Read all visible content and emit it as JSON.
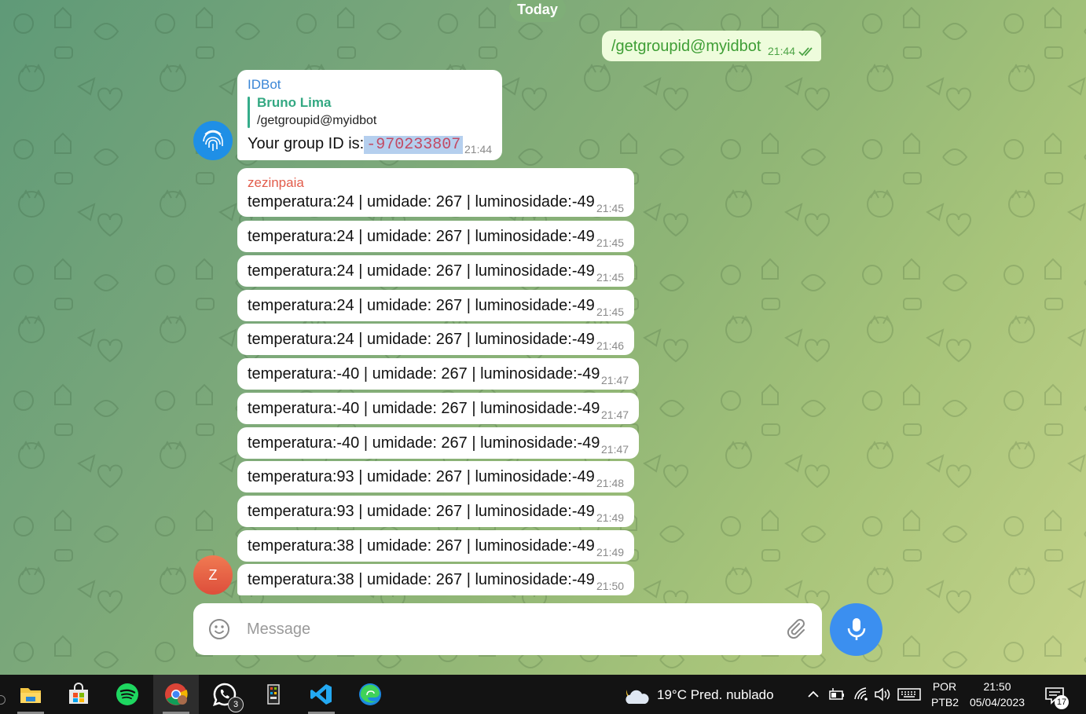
{
  "chat": {
    "date_label": "Today",
    "outgoing": {
      "text": "/getgroupid@myidbot",
      "time": "21:44",
      "status_icon": "double-check-icon"
    },
    "idbot_message": {
      "avatar_icon": "fingerprint-icon",
      "sender": "IDBot",
      "reply_name": "Bruno Lima",
      "reply_text": "/getgroupid@myidbot",
      "text_prefix": "Your group ID is:",
      "group_id": "-970233807",
      "time": "21:44"
    },
    "group_sender": "zezinpaia",
    "group_sender_avatar": "Z",
    "group_messages": [
      {
        "text": "temperatura:24 | umidade: 267 | luminosidade:-49",
        "time": "21:45"
      },
      {
        "text": "temperatura:24 | umidade: 267 | luminosidade:-49",
        "time": "21:45"
      },
      {
        "text": "temperatura:24 | umidade: 267 | luminosidade:-49",
        "time": "21:45"
      },
      {
        "text": "temperatura:24 | umidade: 267 | luminosidade:-49",
        "time": "21:45"
      },
      {
        "text": "temperatura:24 | umidade: 267 | luminosidade:-49",
        "time": "21:46"
      },
      {
        "text": "temperatura:-40 | umidade: 267 | luminosidade:-49",
        "time": "21:47"
      },
      {
        "text": "temperatura:-40 | umidade: 267 | luminosidade:-49",
        "time": "21:47"
      },
      {
        "text": "temperatura:-40 | umidade: 267 | luminosidade:-49",
        "time": "21:47"
      },
      {
        "text": "temperatura:93 | umidade: 267 | luminosidade:-49",
        "time": "21:48"
      },
      {
        "text": "temperatura:93 | umidade: 267 | luminosidade:-49",
        "time": "21:49"
      },
      {
        "text": "temperatura:38 | umidade: 267 | luminosidade:-49",
        "time": "21:49"
      },
      {
        "text": "temperatura:38 | umidade: 267 | luminosidade:-49",
        "time": "21:50"
      }
    ]
  },
  "composer": {
    "placeholder": "Message"
  },
  "taskbar": {
    "apps": [
      "file-explorer-icon",
      "microsoft-store-icon",
      "spotify-icon",
      "chrome-icon",
      "whatsapp-icon",
      "app-icon",
      "vscode-icon",
      "edge-icon"
    ],
    "whatsapp_badge": "3",
    "weather": {
      "temp": "19°C",
      "condition": "Pred. nublado"
    },
    "language": {
      "top": "POR",
      "bottom": "PTB2"
    },
    "clock": {
      "time": "21:50",
      "date": "05/04/2023"
    },
    "notifications": "17"
  },
  "colors": {
    "outgoing_bubble": "#eefcdc",
    "accent_blue": "#3b8ff0",
    "idbot_name": "#3a86d6",
    "reply_name": "#33a882",
    "group_sender": "#e25c4b"
  }
}
